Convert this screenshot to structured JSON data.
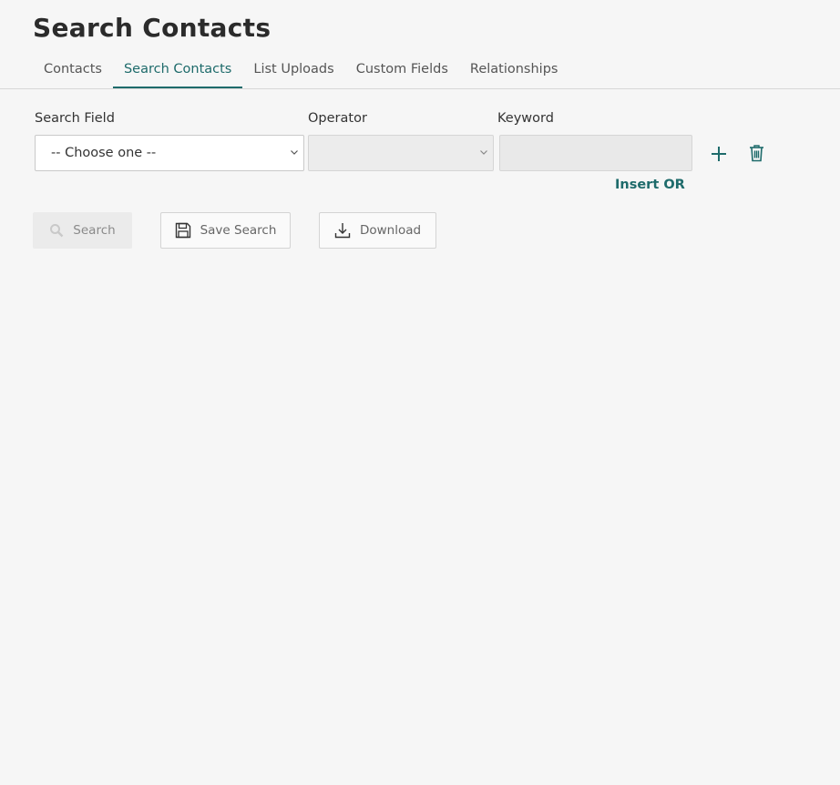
{
  "page": {
    "title": "Search Contacts"
  },
  "tabs": [
    {
      "label": "Contacts",
      "active": false
    },
    {
      "label": "Search Contacts",
      "active": true
    },
    {
      "label": "List Uploads",
      "active": false
    },
    {
      "label": "Custom Fields",
      "active": false
    },
    {
      "label": "Relationships",
      "active": false
    }
  ],
  "search_row": {
    "search_field": {
      "label": "Search Field",
      "selected": "-- Choose one --"
    },
    "operator": {
      "label": "Operator",
      "selected": ""
    },
    "keyword": {
      "label": "Keyword",
      "value": "",
      "placeholder": ""
    },
    "add_icon": "plus-icon",
    "delete_icon": "trash-icon",
    "insert_or_label": "Insert OR"
  },
  "actions": {
    "search_label": "Search",
    "save_search_label": "Save Search",
    "download_label": "Download"
  },
  "colors": {
    "accent": "#1e6b6b",
    "background": "#f6f6f6",
    "title": "#2b2b2b"
  }
}
